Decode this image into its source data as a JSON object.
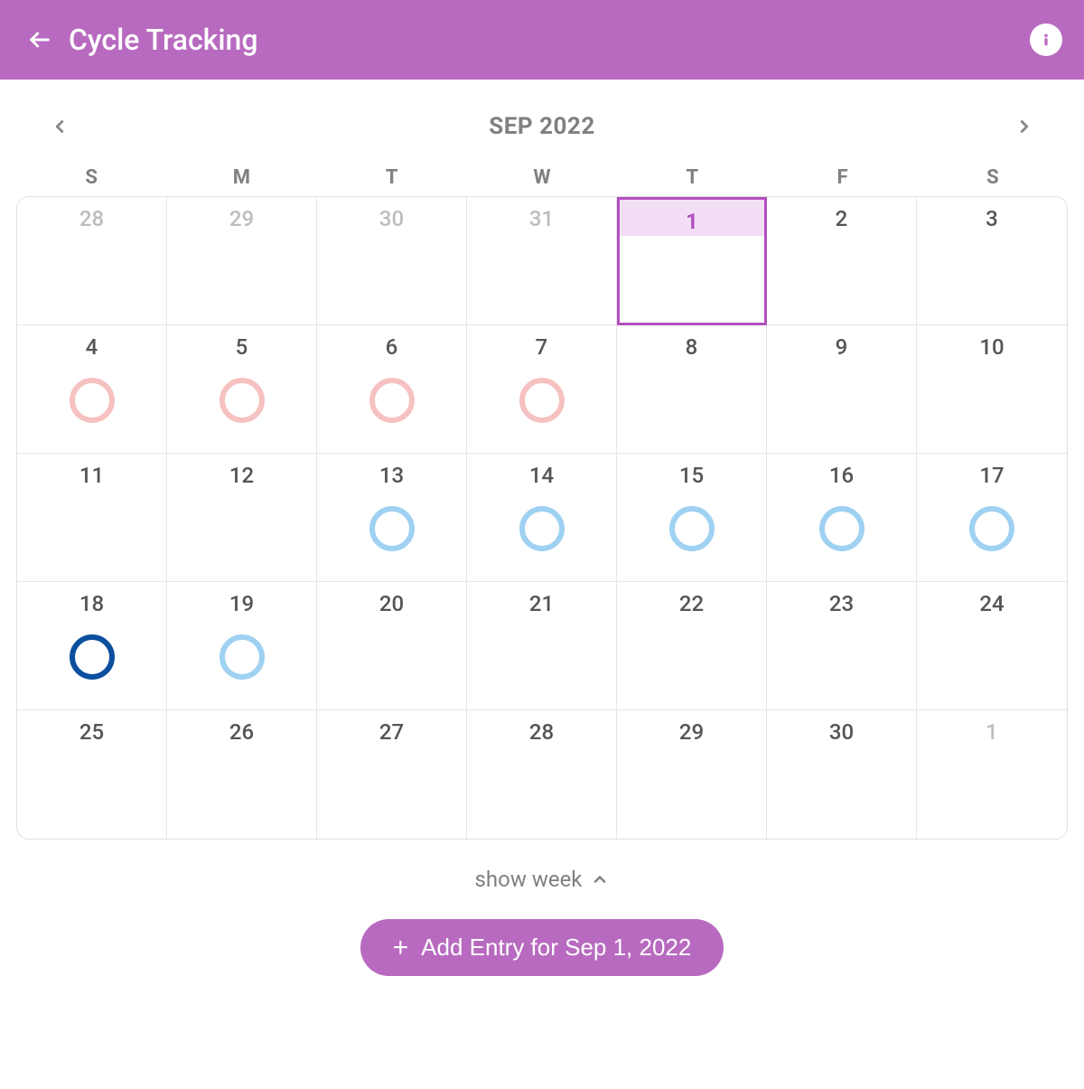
{
  "header": {
    "title": "Cycle Tracking"
  },
  "calendar": {
    "month_label": "SEP 2022",
    "dow": [
      "S",
      "M",
      "T",
      "W",
      "T",
      "F",
      "S"
    ],
    "days": [
      {
        "n": "28",
        "faded": true,
        "marker": null,
        "selected": false
      },
      {
        "n": "29",
        "faded": true,
        "marker": null,
        "selected": false
      },
      {
        "n": "30",
        "faded": true,
        "marker": null,
        "selected": false
      },
      {
        "n": "31",
        "faded": true,
        "marker": null,
        "selected": false
      },
      {
        "n": "1",
        "faded": false,
        "marker": null,
        "selected": true
      },
      {
        "n": "2",
        "faded": false,
        "marker": null,
        "selected": false
      },
      {
        "n": "3",
        "faded": false,
        "marker": null,
        "selected": false
      },
      {
        "n": "4",
        "faded": false,
        "marker": "pink",
        "selected": false
      },
      {
        "n": "5",
        "faded": false,
        "marker": "pink",
        "selected": false
      },
      {
        "n": "6",
        "faded": false,
        "marker": "pink",
        "selected": false
      },
      {
        "n": "7",
        "faded": false,
        "marker": "pink",
        "selected": false
      },
      {
        "n": "8",
        "faded": false,
        "marker": null,
        "selected": false
      },
      {
        "n": "9",
        "faded": false,
        "marker": null,
        "selected": false
      },
      {
        "n": "10",
        "faded": false,
        "marker": null,
        "selected": false
      },
      {
        "n": "11",
        "faded": false,
        "marker": null,
        "selected": false
      },
      {
        "n": "12",
        "faded": false,
        "marker": null,
        "selected": false
      },
      {
        "n": "13",
        "faded": false,
        "marker": "blue",
        "selected": false
      },
      {
        "n": "14",
        "faded": false,
        "marker": "blue",
        "selected": false
      },
      {
        "n": "15",
        "faded": false,
        "marker": "blue",
        "selected": false
      },
      {
        "n": "16",
        "faded": false,
        "marker": "blue",
        "selected": false
      },
      {
        "n": "17",
        "faded": false,
        "marker": "blue",
        "selected": false
      },
      {
        "n": "18",
        "faded": false,
        "marker": "dark",
        "selected": false
      },
      {
        "n": "19",
        "faded": false,
        "marker": "blue",
        "selected": false
      },
      {
        "n": "20",
        "faded": false,
        "marker": null,
        "selected": false
      },
      {
        "n": "21",
        "faded": false,
        "marker": null,
        "selected": false
      },
      {
        "n": "22",
        "faded": false,
        "marker": null,
        "selected": false
      },
      {
        "n": "23",
        "faded": false,
        "marker": null,
        "selected": false
      },
      {
        "n": "24",
        "faded": false,
        "marker": null,
        "selected": false
      },
      {
        "n": "25",
        "faded": false,
        "marker": null,
        "selected": false
      },
      {
        "n": "26",
        "faded": false,
        "marker": null,
        "selected": false
      },
      {
        "n": "27",
        "faded": false,
        "marker": null,
        "selected": false
      },
      {
        "n": "28",
        "faded": false,
        "marker": null,
        "selected": false
      },
      {
        "n": "29",
        "faded": false,
        "marker": null,
        "selected": false
      },
      {
        "n": "30",
        "faded": false,
        "marker": null,
        "selected": false
      },
      {
        "n": "1",
        "faded": true,
        "marker": null,
        "selected": false
      }
    ]
  },
  "toggle": {
    "label": "show week"
  },
  "add_button": {
    "label": "Add Entry for Sep 1, 2022"
  }
}
